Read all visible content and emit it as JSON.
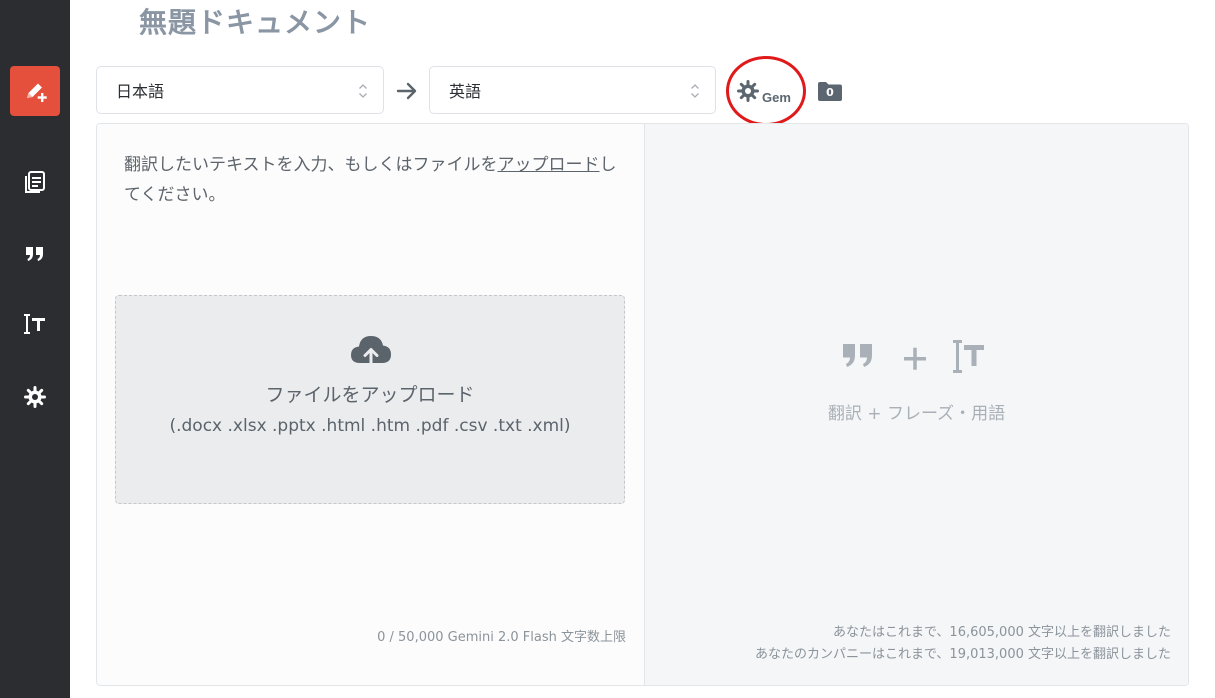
{
  "document": {
    "title": "無題ドキュメント"
  },
  "languages": {
    "source": "日本語",
    "target": "英語"
  },
  "toolbar": {
    "gem_label": "Gem",
    "folder_count": "0"
  },
  "source_panel": {
    "placeholder_before": "翻訳したいテキストを入力、もしくはファイルを",
    "placeholder_link": "アップロード",
    "placeholder_after": "してください。",
    "upload_title": "ファイルをアップロード",
    "upload_types": "(.docx .xlsx .pptx .html .htm .pdf .csv .txt .xml)",
    "char_limit": "0 / 50,000 Gemini 2.0 Flash 文字数上限"
  },
  "target_panel": {
    "caption": "翻訳 + フレーズ・用語",
    "stats_user": "あなたはこれまで、16,605,000 文字以上を翻訳しました",
    "stats_company": "あなたのカンパニーはこれまで、19,013,000 文字以上を翻訳しました"
  },
  "colors": {
    "sidebar_bg": "#2c2d30",
    "accent": "#e4503c",
    "annotation_circle": "#e01a1a"
  },
  "icons": {
    "sidebar": [
      "pen-plus-icon",
      "document-list-icon",
      "quote-icon",
      "text-cursor-icon",
      "gear-icon"
    ],
    "toolbar": [
      "gear-icon",
      "folder-icon"
    ],
    "upload": "cloud-upload-icon"
  }
}
